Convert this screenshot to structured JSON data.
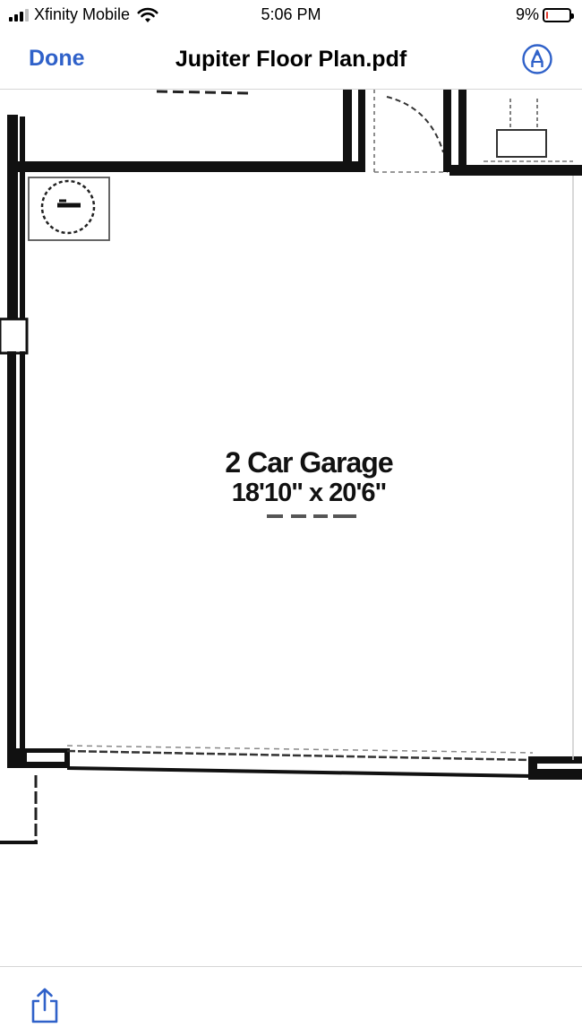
{
  "status_bar": {
    "carrier": "Xfinity Mobile",
    "time": "5:06 PM",
    "battery_percent": "9%",
    "battery_level": 0.09,
    "battery_color": "#e23b2e"
  },
  "nav": {
    "done_label": "Done",
    "title": "Jupiter Floor Plan.pdf",
    "markup_icon": "markup-pen-icon",
    "accent": "#2f61c9"
  },
  "document": {
    "room_name": "2 Car Garage",
    "room_dimensions": "18'10\" x 20'6\""
  },
  "toolbar": {
    "share_icon": "share-icon"
  }
}
